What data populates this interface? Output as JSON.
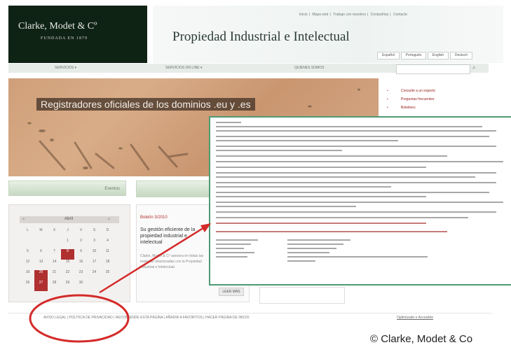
{
  "header": {
    "logo_name": "Clarke, Modet & Cº",
    "logo_sub": "FUNDADA EN 1879",
    "site_title": "Propiedad Industrial e Intelectual",
    "top_links": [
      "Inicio",
      "Mapa web",
      "Trabajo con nosotros",
      "Compañías",
      "Contacto"
    ],
    "languages": [
      "Español",
      "Português",
      "English",
      "Deutsch"
    ]
  },
  "nav": {
    "items": [
      "SERVICIOS ▾",
      "SERVICIOS ON LINE ▾",
      "QUIENES SOMOS"
    ],
    "search_placeholder": ""
  },
  "banner": {
    "caption": "Registradores oficiales de los dominios .eu y .es"
  },
  "sidebar": {
    "links": [
      "Consulte a un experto",
      "Preguntas frecuentes",
      "Boletines"
    ]
  },
  "buttons": {
    "left": "Eventos",
    "right": ""
  },
  "calendar": {
    "month": "Abril",
    "prev": "«",
    "next": "»",
    "weekdays": [
      "L",
      "M",
      "X",
      "J",
      "V",
      "S",
      "D"
    ],
    "days": [
      "",
      "",
      "",
      "1",
      "2",
      "3",
      "4",
      "5",
      "6",
      "7",
      "8",
      "9",
      "10",
      "11",
      "12",
      "13",
      "14",
      "15",
      "16",
      "17",
      "18",
      "19",
      "20",
      "21",
      "22",
      "23",
      "24",
      "25",
      "26",
      "27",
      "28",
      "29",
      "30"
    ],
    "marked_days": [
      "8",
      "20",
      "27"
    ]
  },
  "news": {
    "date": "Boletín 3/2010",
    "title": "Su gestión eficiente de la propiedad industrial e intelectual",
    "body": "Clarke, Modet & Cº asesora en todas las materias relacionadas con la Propiedad Industrial e Intelectual.",
    "read_more": "LEER MÁS"
  },
  "footer": {
    "links": "AVISO LEGAL | POLÍTICA DE PRIVACIDAD | RECOMIENDE ESTA PÁGINA | AÑADIR A FAVORITOS | HACER PÁGINA DE INICIO",
    "credit": "Optimizado e Accesible"
  },
  "copyright": "© Clarke, Modet & Co",
  "colors": {
    "accent_red": "#d42a2a",
    "doc_border": "#4f9a73",
    "logo_bg": "#0f2314"
  }
}
